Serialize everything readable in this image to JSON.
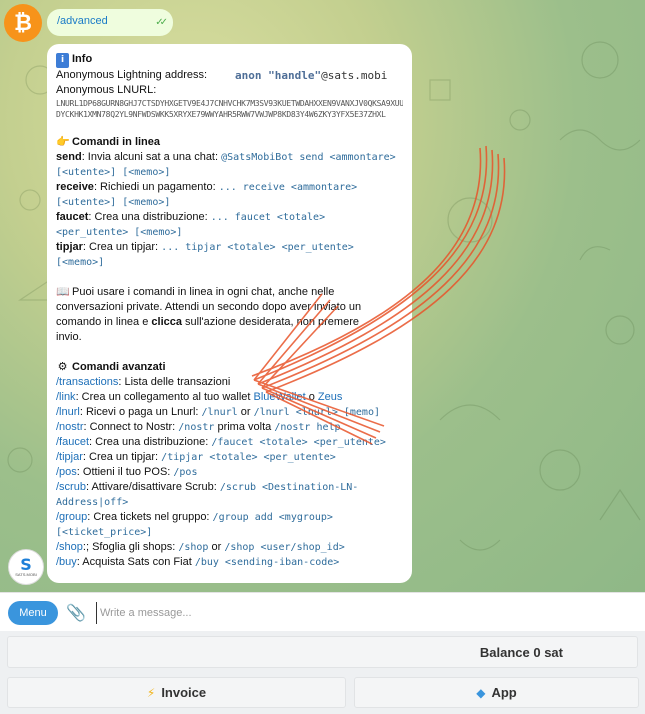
{
  "sent_message": {
    "text": "/advanced"
  },
  "info": {
    "title": "Info",
    "address_label": "Anonymous Lightning address:",
    "handle_placeholder": "anon \"handle\"",
    "handle_domain": "@sats.mobi",
    "lnurl_label": "Anonymous LNURL:",
    "lnurl_line1": "LNURL1DP68GURN8GHJ7CTSDYHXGETV9E4J7CNHVCHK7M3SV93KUETWDAHXXEN9VANXJV0QKSA9XUUXW",
    "lnurl_line2": "DYCKHK1XMN78Q2YL9NFWDSWKK5XRYXE79WWYAHR5RWW7VWJWP8KD83Y4W6ZKY3YFX5E37ZHXL"
  },
  "inline": {
    "title": "Comandi in linea",
    "send_label": "send",
    "send_text": ": Invia alcuni sat a una chat: ",
    "send_cmd": "@SatsMobiBot send <ammontare>",
    "send_cmd2": "[<utente>] [<memo>]",
    "receive_label": "receive",
    "receive_text": ": Richiedi un pagamento: ",
    "receive_cmd": "... receive <ammontare>",
    "receive_cmd2": "[<utente>] [<memo>]",
    "faucet_label": "faucet",
    "faucet_text": ": Crea una distribuzione: ",
    "faucet_cmd": "... faucet <totale>",
    "faucet_cmd2": "<per_utente> [<memo>]",
    "tipjar_label": "tipjar",
    "tipjar_text": ": Crea un tipjar: ",
    "tipjar_cmd": "... tipjar <totale> <per_utente>",
    "tipjar_cmd2": "[<memo>]"
  },
  "note": {
    "line1": "Puoi usare i comandi in linea in ogni chat, anche nelle",
    "line2": "conversazioni private. Attendi un secondo dopo aver inviato un",
    "line3a": "comando in linea e ",
    "line3b": "clicca",
    "line3c": " sull'azione desiderata, non premere",
    "line4": "invio."
  },
  "advanced": {
    "title": "Comandi avanzati",
    "transactions_cmd": "/transactions",
    "transactions_text": ": Lista delle transazioni",
    "link_cmd": "/link",
    "link_text": ": Crea un collegamento al tuo wallet ",
    "link_bw": "BlueWallet",
    "link_or": " o ",
    "link_zeus": "Zeus",
    "lnurl_cmd": "/lnurl",
    "lnurl_text": ": Ricevi o paga un Lnurl: ",
    "lnurl_m1": "/lnurl",
    "lnurl_or": " or ",
    "lnurl_m2": "/lnurl <lnurl> [memo]",
    "nostr_cmd": "/nostr",
    "nostr_text": ": Connect to Nostr: ",
    "nostr_m1": "/nostr",
    "nostr_mid": " prima volta ",
    "nostr_m2": "/nostr help",
    "faucet_cmd": "/faucet",
    "faucet_text": ": Crea una distribuzione: ",
    "faucet_m": "/faucet <totale> <per_utente>",
    "tipjar_cmd": "/tipjar",
    "tipjar_text": ": Crea un tipjar: ",
    "tipjar_m": "/tipjar <totale> <per_utente>",
    "pos_cmd": "/pos",
    "pos_text": ": Ottieni il tuo POS: ",
    "pos_m": "/pos",
    "scrub_cmd": "/scrub",
    "scrub_text": ": Attivare/disattivare Scrub: ",
    "scrub_m": "/scrub <Destination-LN-",
    "scrub_m2": "Address|off>",
    "group_cmd": "/group",
    "group_text": ": Crea tickets nel gruppo: ",
    "group_m": "/group add <mygroup>",
    "group_m2": "[<ticket_price>]",
    "shop_cmd": "/shop",
    "shop_text": ":; Sfoglia gli shops: ",
    "shop_m1": "/shop",
    "shop_or": " or ",
    "shop_m2": "/shop <user/shop_id>",
    "buy_cmd": "/buy",
    "buy_text": ": Acquista Sats con Fiat ",
    "buy_m": "/buy <sending-iban-code>"
  },
  "composer": {
    "menu_label": "Menu",
    "placeholder": "Write a message..."
  },
  "keyboard": {
    "balance": "Balance 0 sat",
    "invoice": "Invoice",
    "app": "App"
  },
  "icons": {
    "user_avatar": "bitcoin-icon",
    "bot_avatar": "satsmobi-icon",
    "info": "info-icon",
    "inline": "pointing-hand-icon",
    "note": "book-icon",
    "advanced": "gear-icon",
    "invoice": "lightning-icon",
    "app": "cube-icon"
  },
  "colors": {
    "menu_button": "#3a95dd",
    "link": "#1d6fb8",
    "annotation_arrow": "#e8542a",
    "outgoing_bubble": "#effdde"
  }
}
